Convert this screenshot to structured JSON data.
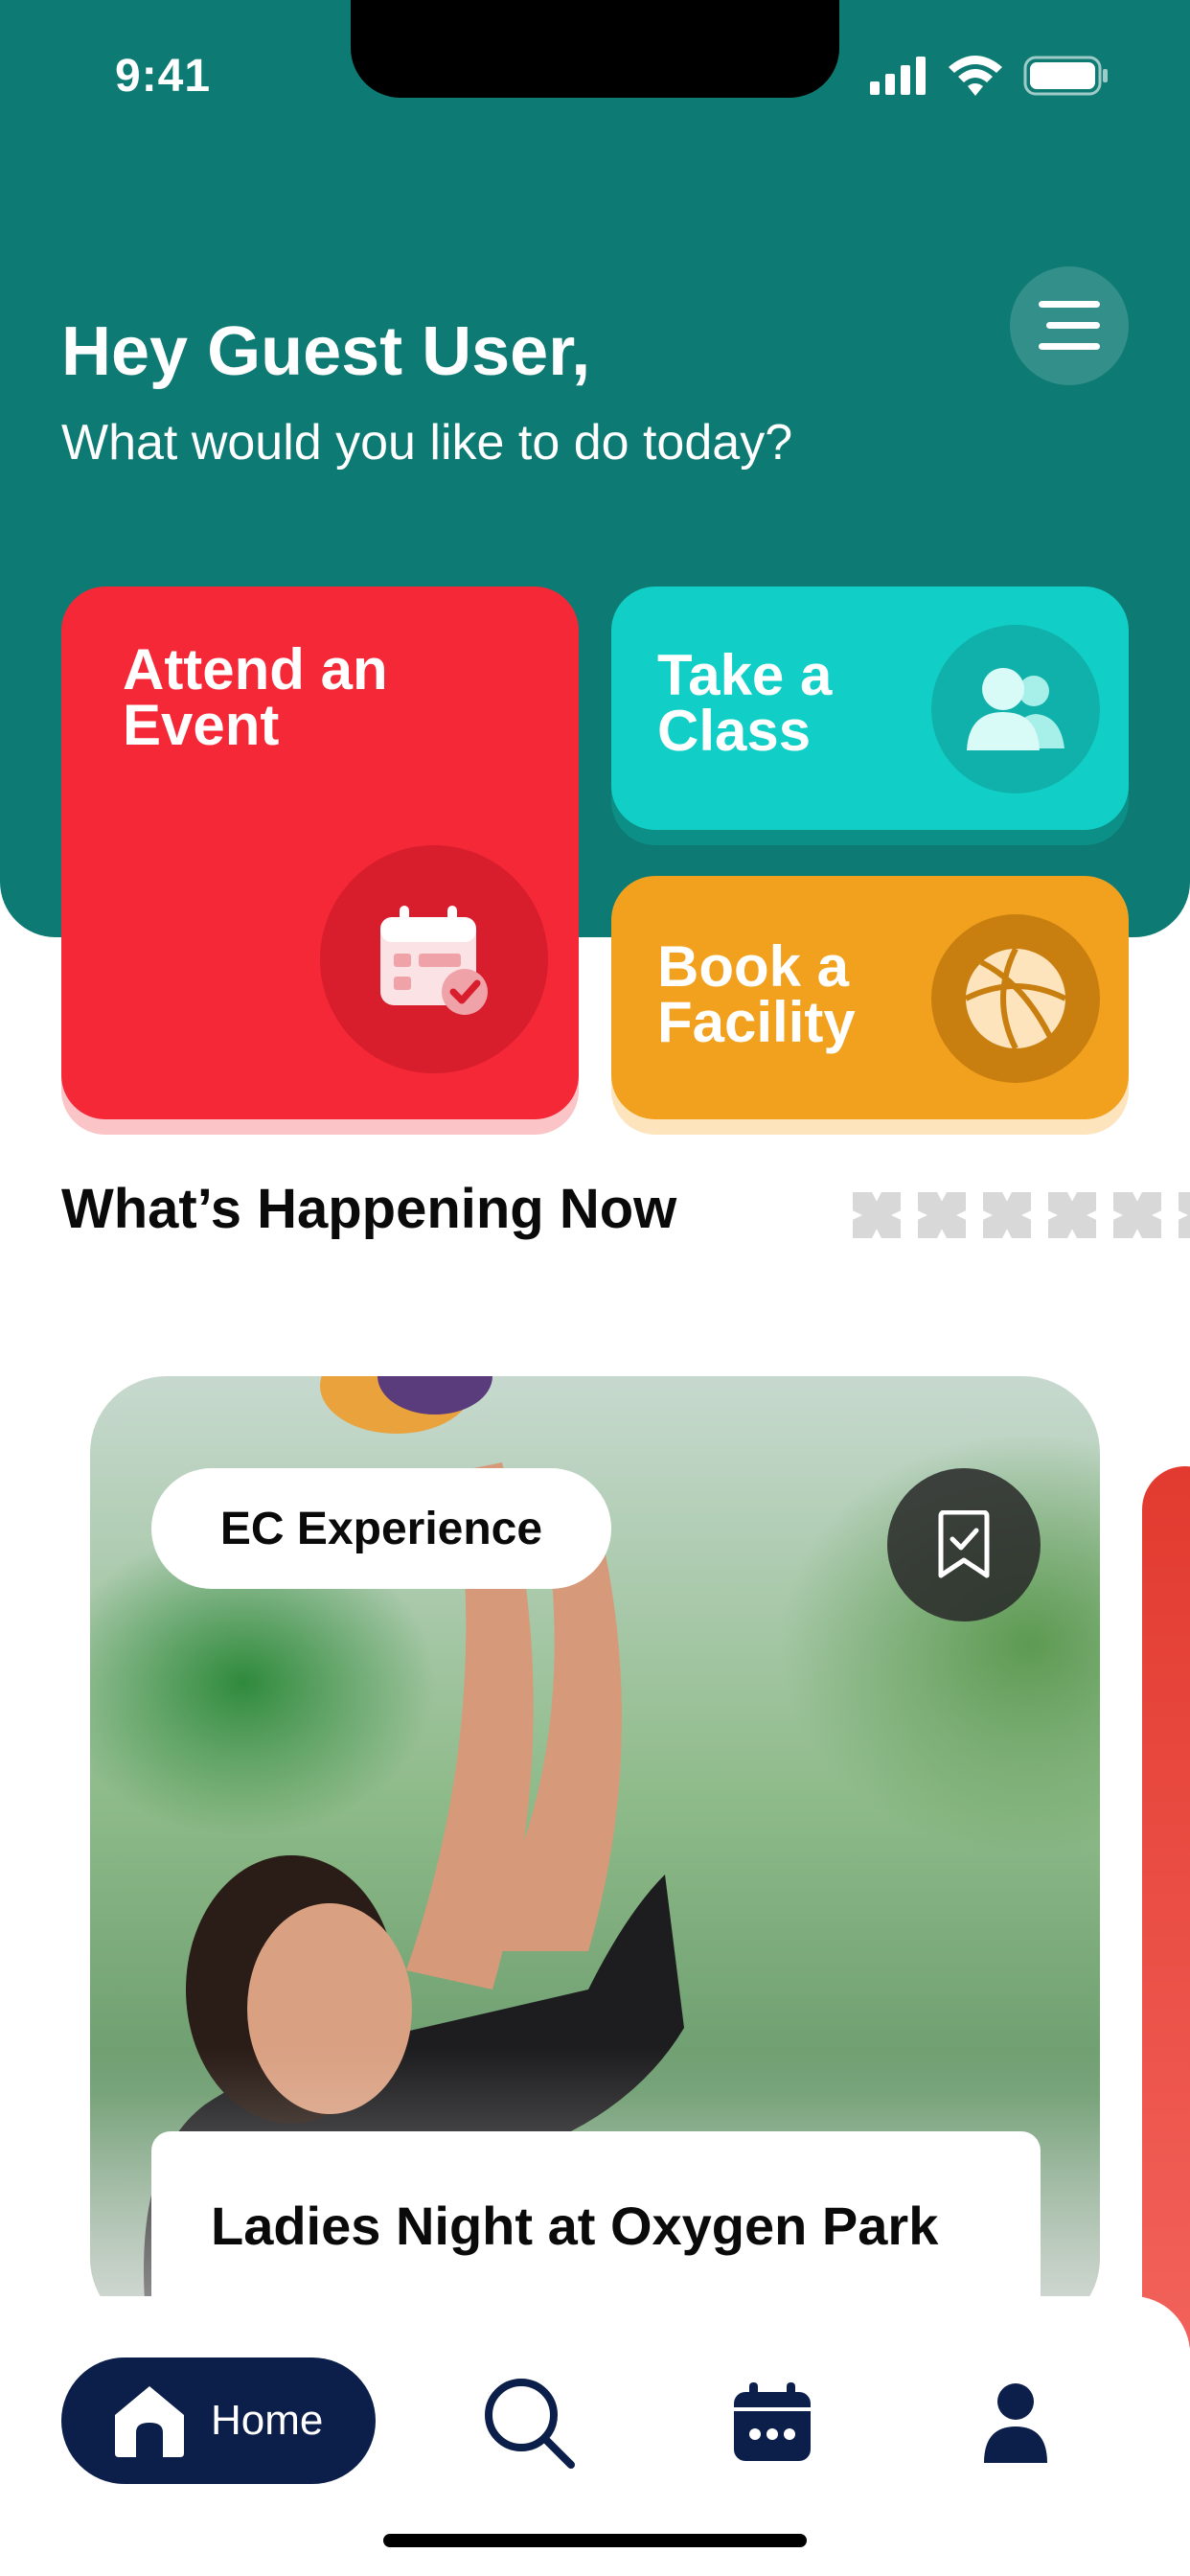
{
  "status_bar": {
    "time": "9:41"
  },
  "header": {
    "greeting": "Hey Guest User,",
    "subtitle": "What would you like to do today?"
  },
  "quick_actions": [
    {
      "label_line1": "Attend an",
      "label_line2": "Event",
      "icon": "calendar-check-icon",
      "color": "#f52837"
    },
    {
      "label_line1": "Take a",
      "label_line2": "Class",
      "icon": "users-icon",
      "color": "#11cfc6"
    },
    {
      "label_line1": "Book a",
      "label_line2": "Facility",
      "icon": "basketball-icon",
      "color": "#f2a11f"
    }
  ],
  "section": {
    "title": "What’s Happening Now"
  },
  "featured_card": {
    "tag": "EC Experience",
    "title": "Ladies Night at Oxygen Park",
    "bookmark_icon": "bookmark-icon"
  },
  "bottom_nav": {
    "home_label": "Home",
    "items": [
      "home-icon",
      "search-icon",
      "calendar-icon",
      "profile-icon"
    ],
    "active": "Home",
    "active_color": "#0c1e4a"
  },
  "colors": {
    "header": "#0d7a73",
    "text_dark": "#0a0a0a"
  }
}
